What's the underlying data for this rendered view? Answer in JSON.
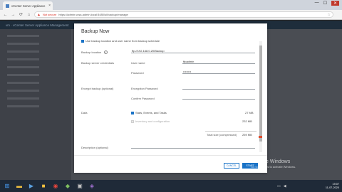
{
  "browser": {
    "tab_title": "vCenter Server Appliance",
    "tab_close": "×",
    "not_secure": "Not secure",
    "url": "https://admin.vcsa.admin.local:5480/ui/backup/manage",
    "back": "←",
    "forward": "→",
    "reload": "⟳",
    "home": "⌂",
    "star": "☆",
    "win_minimize": "—",
    "win_maximize": "☐",
    "win_close": "✕"
  },
  "app": {
    "header_text": "vm · vCenter Server Appliance Management"
  },
  "modal": {
    "title": "Backup Now",
    "use_backup_location_text": "Use backup location and user name from backup schedule",
    "backup_location_label": "Backup location",
    "backup_location_info": "i",
    "backup_location_value": "ftp://192.168.0.20/Backup",
    "credentials_label": "Backup server credentials",
    "username_label": "User name",
    "username_value": "ftpadmin",
    "password_label": "Password",
    "password_value": "••••••••",
    "encrypt_label": "Encrypt backup (optional)",
    "encryption_password_label": "Encryption Password",
    "confirm_password_label": "Confirm Password",
    "data_label": "Data",
    "stats_label": "Stats, Events, and Tasks",
    "stats_size": "27 MB",
    "inventory_label": "Inventory and configuration",
    "inventory_size": "232 MB",
    "total_label": "Total size (compressed)",
    "total_size": "259 MB",
    "description_label": "Description (optional)",
    "cancel_label": "CANCEL",
    "start_label": "START"
  },
  "watermark": {
    "line1": "Activate Windows",
    "line2": "Go to Settings to activate Windows."
  },
  "taskbar": {
    "time": "19:07",
    "date": "11-07-2020"
  },
  "colors": {
    "accent": "#1a73c7",
    "taskbar": "#1f2a38"
  }
}
